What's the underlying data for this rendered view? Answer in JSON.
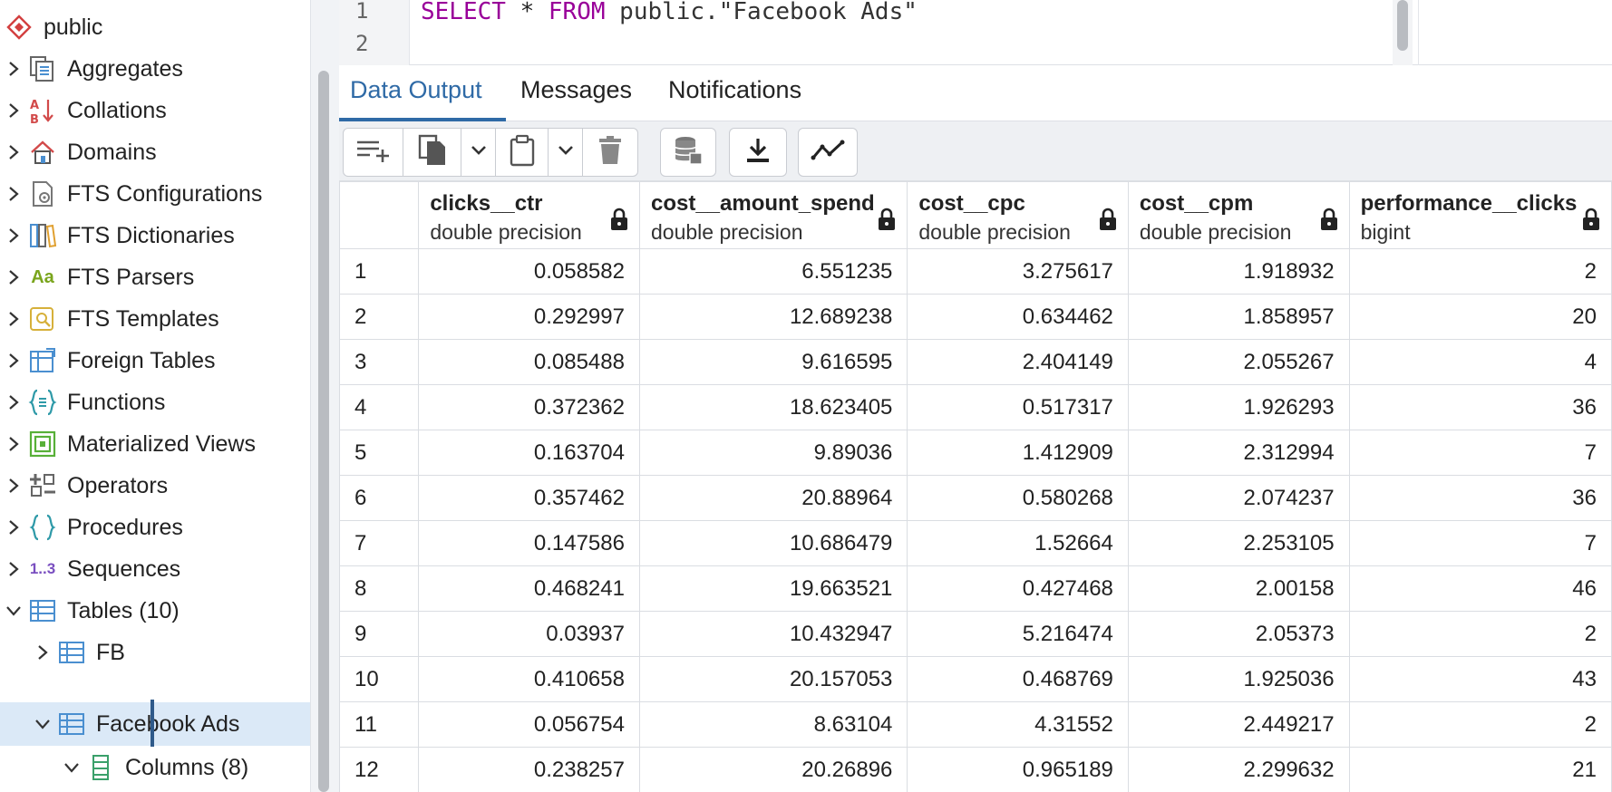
{
  "sidebar": {
    "items": [
      {
        "label": "public",
        "icon": "schema-icon",
        "expand": "none"
      },
      {
        "label": "Aggregates",
        "icon": "aggregates-icon",
        "expand": "collapsed"
      },
      {
        "label": "Collations",
        "icon": "collations-icon",
        "expand": "collapsed"
      },
      {
        "label": "Domains",
        "icon": "domains-icon",
        "expand": "collapsed"
      },
      {
        "label": "FTS Configurations",
        "icon": "fts-configurations-icon",
        "expand": "collapsed"
      },
      {
        "label": "FTS Dictionaries",
        "icon": "fts-dictionaries-icon",
        "expand": "collapsed"
      },
      {
        "label": "FTS Parsers",
        "icon": "fts-parsers-icon",
        "expand": "collapsed"
      },
      {
        "label": "FTS Templates",
        "icon": "fts-templates-icon",
        "expand": "collapsed"
      },
      {
        "label": "Foreign Tables",
        "icon": "foreign-tables-icon",
        "expand": "collapsed"
      },
      {
        "label": "Functions",
        "icon": "functions-icon",
        "expand": "collapsed"
      },
      {
        "label": "Materialized Views",
        "icon": "materialized-views-icon",
        "expand": "collapsed"
      },
      {
        "label": "Operators",
        "icon": "operators-icon",
        "expand": "collapsed"
      },
      {
        "label": "Procedures",
        "icon": "procedures-icon",
        "expand": "collapsed"
      },
      {
        "label": "Sequences",
        "icon": "sequences-icon",
        "expand": "collapsed"
      },
      {
        "label": "Tables (10)",
        "icon": "tables-icon",
        "expand": "expanded"
      },
      {
        "label": "FB",
        "icon": "table-icon",
        "expand": "collapsed"
      },
      {
        "label": "Facebook Ads",
        "icon": "table-icon",
        "expand": "expanded",
        "selected": true
      },
      {
        "label": "Columns (8)",
        "icon": "columns-icon",
        "expand": "expanded"
      }
    ],
    "fts_parsers_glyph": "Aa",
    "sequences_glyph": "1..3"
  },
  "editor": {
    "line_numbers": [
      "1",
      "2"
    ],
    "query": {
      "kw_select": "SELECT",
      "star": " * ",
      "kw_from": "FROM",
      "target": " public.\"Facebook Ads\""
    }
  },
  "tabs": [
    "Data Output",
    "Messages",
    "Notifications"
  ],
  "active_tab": "Data Output",
  "toolbar": {
    "buttons": [
      "add-row-icon",
      "copy-icon",
      "chevron-down-icon",
      "paste-icon",
      "chevron-down-icon",
      "delete-icon",
      "save-data-icon",
      "download-icon",
      "graph-visualiser-icon"
    ]
  },
  "grid": {
    "columns": [
      {
        "name": "clicks__ctr",
        "type": "double precision"
      },
      {
        "name": "cost__amount_spend",
        "type": "double precision"
      },
      {
        "name": "cost__cpc",
        "type": "double precision"
      },
      {
        "name": "cost__cpm",
        "type": "double precision"
      },
      {
        "name": "performance__clicks",
        "type": "bigint"
      }
    ],
    "rows": [
      [
        "1",
        "0.058582",
        "6.551235",
        "3.275617",
        "1.918932",
        "2"
      ],
      [
        "2",
        "0.292997",
        "12.689238",
        "0.634462",
        "1.858957",
        "20"
      ],
      [
        "3",
        "0.085488",
        "9.616595",
        "2.404149",
        "2.055267",
        "4"
      ],
      [
        "4",
        "0.372362",
        "18.623405",
        "0.517317",
        "1.926293",
        "36"
      ],
      [
        "5",
        "0.163704",
        "9.89036",
        "1.412909",
        "2.312994",
        "7"
      ],
      [
        "6",
        "0.357462",
        "20.88964",
        "0.580268",
        "2.074237",
        "36"
      ],
      [
        "7",
        "0.147586",
        "10.686479",
        "1.52664",
        "2.253105",
        "7"
      ],
      [
        "8",
        "0.468241",
        "19.663521",
        "0.427468",
        "2.00158",
        "46"
      ],
      [
        "9",
        "0.03937",
        "10.432947",
        "5.216474",
        "2.05373",
        "2"
      ],
      [
        "10",
        "0.410658",
        "20.157053",
        "0.468769",
        "1.925036",
        "43"
      ],
      [
        "11",
        "0.056754",
        "8.63104",
        "4.31552",
        "2.449217",
        "2"
      ],
      [
        "12",
        "0.238257",
        "20.26896",
        "0.965189",
        "2.299632",
        "21"
      ]
    ]
  },
  "colors": {
    "accent": "#2f6aa6",
    "keyword": "#990099",
    "selected_row": "#dbe9f7"
  }
}
